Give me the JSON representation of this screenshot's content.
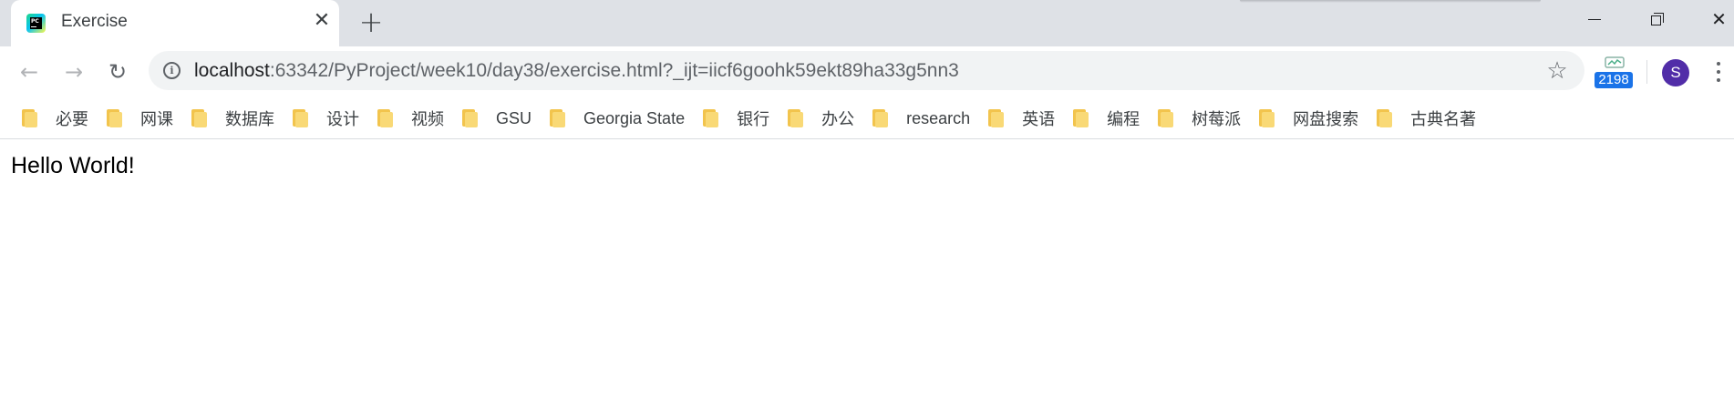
{
  "tab": {
    "favicon": "pycharm-icon",
    "favicon_text": "PC",
    "title": "Exercise",
    "close_glyph": "✕"
  },
  "new_tab_glyph": "+",
  "window_controls": {
    "close_glyph": "✕"
  },
  "toolbar": {
    "back_glyph": "←",
    "forward_glyph": "→",
    "reload_glyph": "↻",
    "info_glyph": "i",
    "url_host": "localhost",
    "url_rest": ":63342/PyProject/week10/day38/exercise.html?_ijt=iicf6goohk59ekt89ha33g5nn3",
    "star_glyph": "☆",
    "extension_badge": "2198",
    "avatar_letter": "S"
  },
  "bookmarks": [
    {
      "label": "必要"
    },
    {
      "label": "网课"
    },
    {
      "label": "数据库"
    },
    {
      "label": "设计"
    },
    {
      "label": "视频"
    },
    {
      "label": "GSU"
    },
    {
      "label": "Georgia State"
    },
    {
      "label": "银行"
    },
    {
      "label": "办公"
    },
    {
      "label": "research"
    },
    {
      "label": "英语"
    },
    {
      "label": "编程"
    },
    {
      "label": "树莓派"
    },
    {
      "label": "网盘搜索"
    },
    {
      "label": "古典名著"
    }
  ],
  "page": {
    "text": "Hello World!"
  },
  "colors": {
    "tabstrip": "#dee1e6",
    "omnibox": "#f1f3f4",
    "avatar": "#512da8",
    "badge": "#1a73e8",
    "folder": "#f9d976"
  }
}
